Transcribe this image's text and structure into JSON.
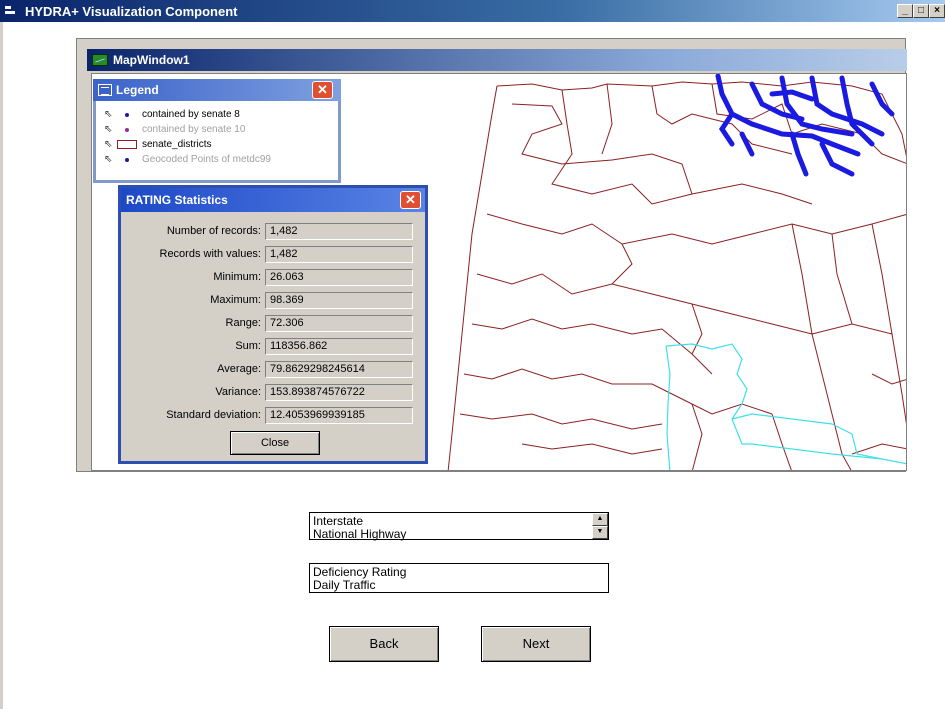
{
  "app": {
    "title": "HYDRA+ Visualization Component",
    "minimize_glyph": "_",
    "maximize_glyph": "□",
    "close_glyph": "×"
  },
  "map_window": {
    "title": "MapWindow1"
  },
  "legend": {
    "title": "Legend",
    "close_glyph": "✕",
    "items": [
      {
        "label": "contained by senate 8",
        "symbol": "point",
        "color": "#1a1aa0",
        "muted": false
      },
      {
        "label": "contained by senate 10",
        "symbol": "point",
        "color": "#9a2a9a",
        "muted": true
      },
      {
        "label": "senate_districts",
        "symbol": "polygon",
        "color": "#8b2020",
        "muted": false
      },
      {
        "label": "Geocoded Points of metdc99",
        "symbol": "point",
        "color": "#1a1aa0",
        "muted": true
      }
    ]
  },
  "stats": {
    "title": "RATING Statistics",
    "close_glyph": "✕",
    "rows": [
      {
        "label": "Number of records:",
        "value": "1,482"
      },
      {
        "label": "Records with values:",
        "value": "1,482"
      },
      {
        "label": "Minimum:",
        "value": "26.063"
      },
      {
        "label": "Maximum:",
        "value": "98.369"
      },
      {
        "label": "Range:",
        "value": "72.306"
      },
      {
        "label": "Sum:",
        "value": "118356.862"
      },
      {
        "label": "Average:",
        "value": "79.8629298245614"
      },
      {
        "label": "Variance:",
        "value": "153.893874576722"
      },
      {
        "label": "Standard deviation:",
        "value": "12.4053969939185"
      }
    ],
    "close_label": "Close"
  },
  "road_type_list": {
    "items": [
      "Interstate",
      "National Highway"
    ]
  },
  "metric_list": {
    "items": [
      "Deficiency Rating",
      "Daily Traffic"
    ]
  },
  "buttons": {
    "back": "Back",
    "next": "Next"
  },
  "colors": {
    "district_boundary": "#8b2020",
    "highlight_district": "#40e0e8",
    "senate8_points": "#1a1ae0",
    "titlebar": "#0a246a"
  }
}
